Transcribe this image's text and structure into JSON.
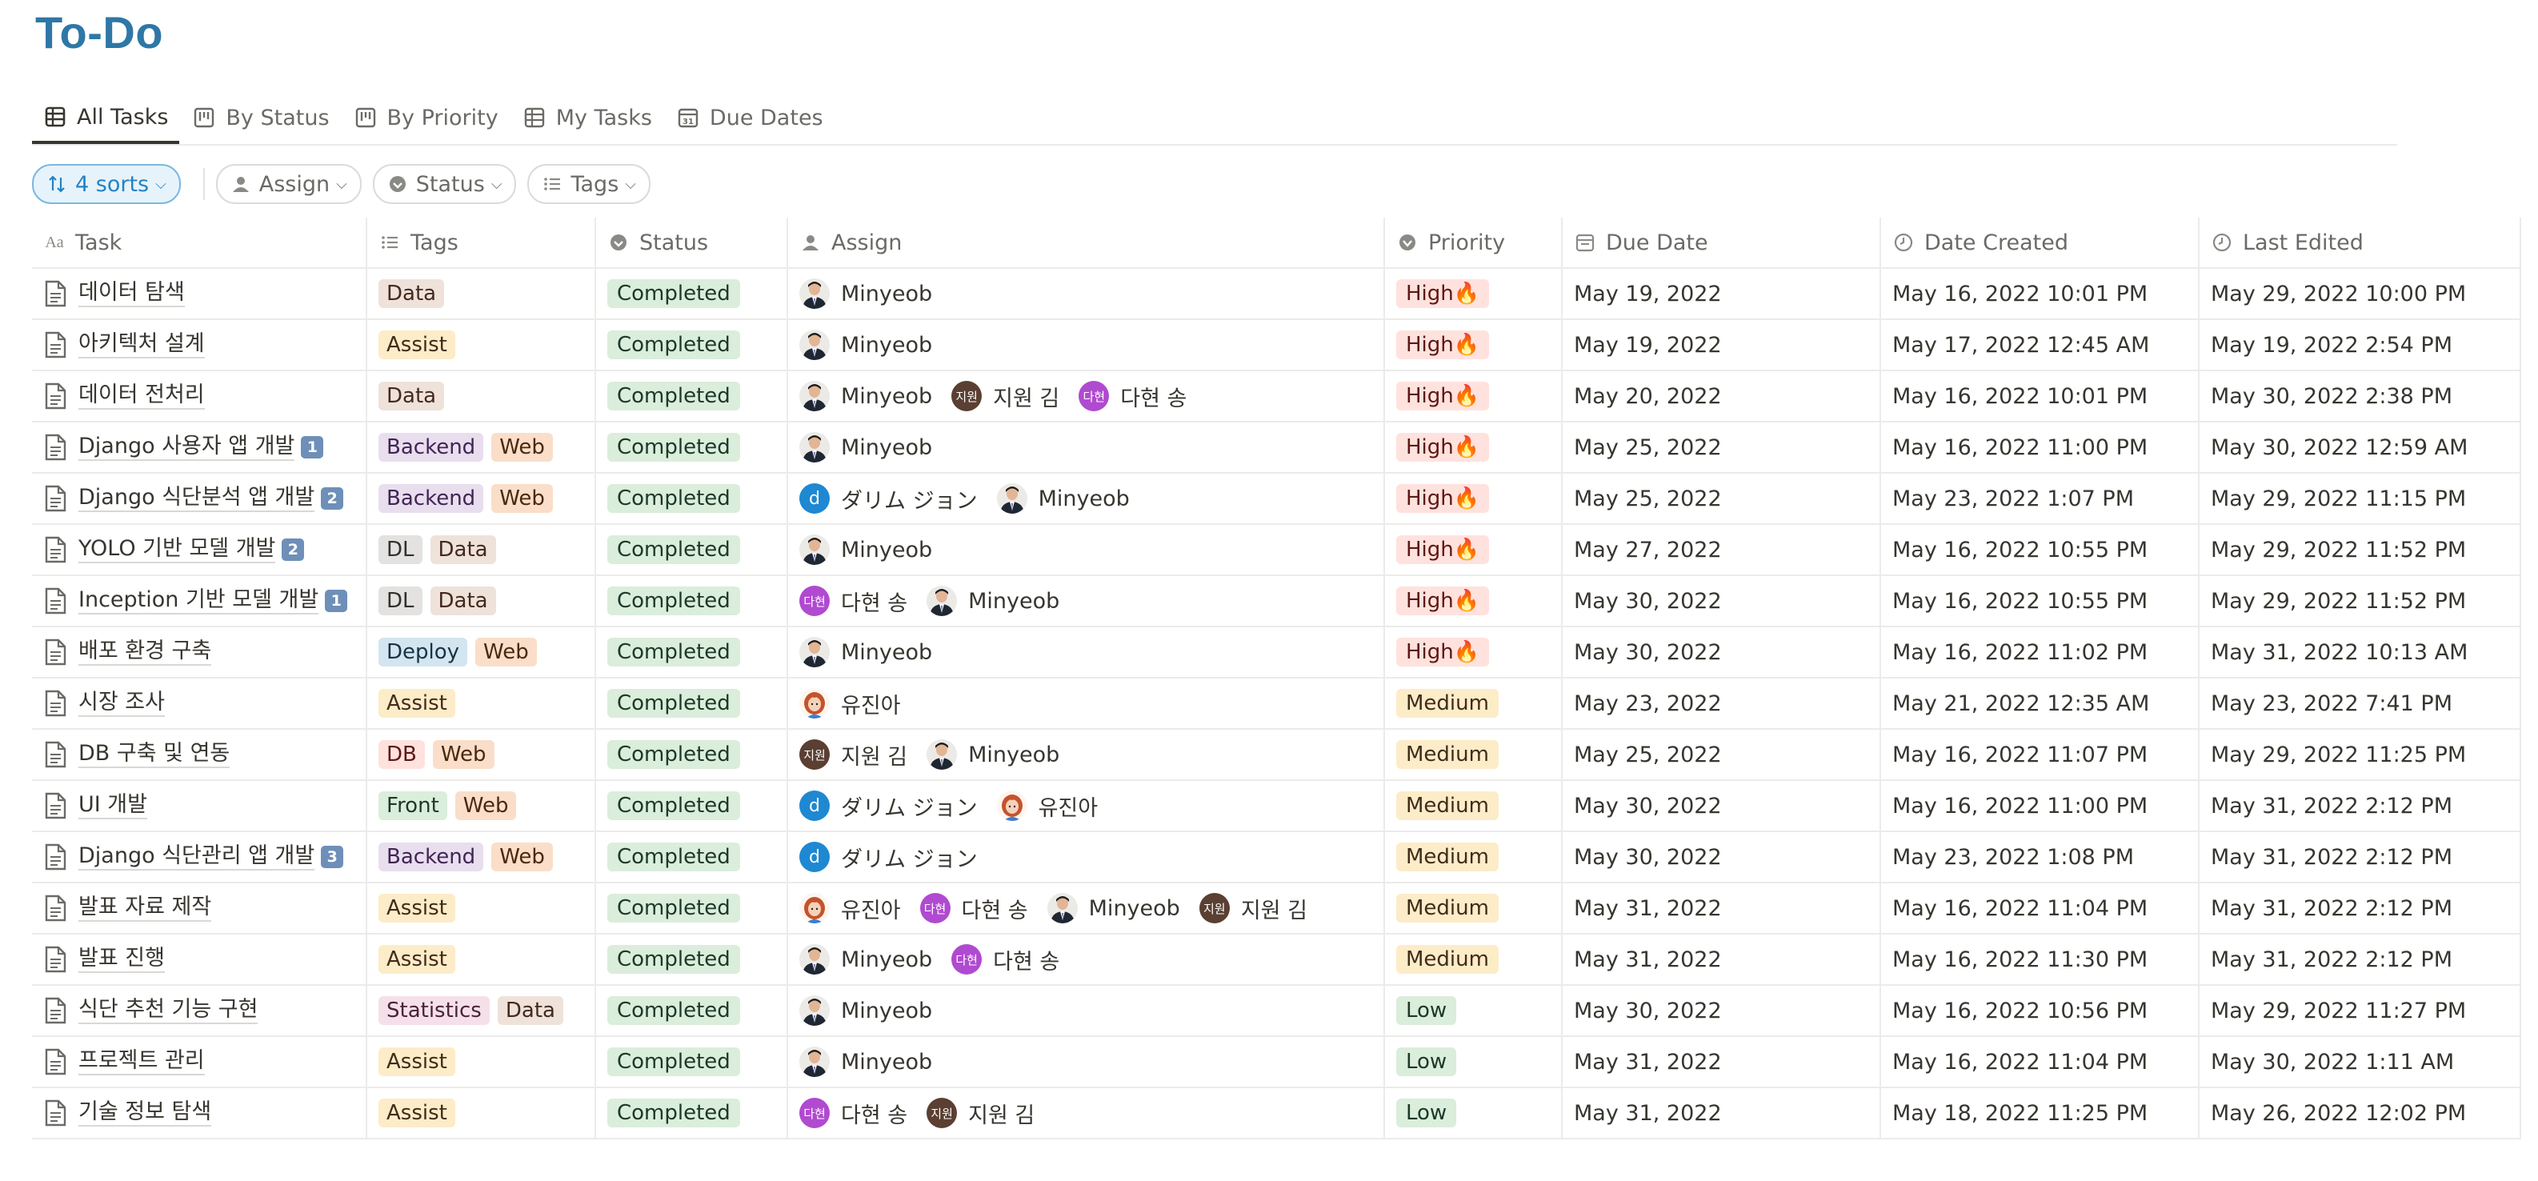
{
  "page": {
    "title": "To-Do"
  },
  "tabs": [
    {
      "label": "All Tasks",
      "icon": "table-icon",
      "active": true
    },
    {
      "label": "By Status",
      "icon": "board-icon",
      "active": false
    },
    {
      "label": "By Priority",
      "icon": "board-icon",
      "active": false
    },
    {
      "label": "My Tasks",
      "icon": "table-icon",
      "active": false
    },
    {
      "label": "Due Dates",
      "icon": "calendar-icon",
      "active": false
    }
  ],
  "filters": {
    "sort_label": "4 sorts",
    "assign_label": "Assign",
    "status_label": "Status",
    "tags_label": "Tags"
  },
  "columns": {
    "task": "Task",
    "tags": "Tags",
    "status": "Status",
    "assign": "Assign",
    "priority": "Priority",
    "due": "Due Date",
    "created": "Date Created",
    "edited": "Last Edited"
  },
  "rows": [
    {
      "task": "데이터 탐색",
      "num": "",
      "tags": [
        "Data"
      ],
      "status": "Completed",
      "assign": [
        "Minyeob"
      ],
      "priority": "High🔥",
      "due": "May 19, 2022",
      "created": "May 16, 2022 10:01 PM",
      "edited": "May 29, 2022 10:00 PM"
    },
    {
      "task": "아키텍처 설계",
      "num": "",
      "tags": [
        "Assist"
      ],
      "status": "Completed",
      "assign": [
        "Minyeob"
      ],
      "priority": "High🔥",
      "due": "May 19, 2022",
      "created": "May 17, 2022 12:45 AM",
      "edited": "May 19, 2022 2:54 PM"
    },
    {
      "task": "데이터 전처리",
      "num": "",
      "tags": [
        "Data"
      ],
      "status": "Completed",
      "assign": [
        "Minyeob",
        "지원 김",
        "다현 송"
      ],
      "priority": "High🔥",
      "due": "May 20, 2022",
      "created": "May 16, 2022 10:01 PM",
      "edited": "May 30, 2022 2:38 PM"
    },
    {
      "task": "Django 사용자 앱 개발",
      "num": "1",
      "tags": [
        "Backend",
        "Web"
      ],
      "status": "Completed",
      "assign": [
        "Minyeob"
      ],
      "priority": "High🔥",
      "due": "May 25, 2022",
      "created": "May 16, 2022 11:00 PM",
      "edited": "May 30, 2022 12:59 AM"
    },
    {
      "task": "Django 식단분석 앱 개발",
      "num": "2",
      "tags": [
        "Backend",
        "Web"
      ],
      "status": "Completed",
      "assign": [
        "ダリム ジョン",
        "Minyeob"
      ],
      "priority": "High🔥",
      "due": "May 25, 2022",
      "created": "May 23, 2022 1:07 PM",
      "edited": "May 29, 2022 11:15 PM"
    },
    {
      "task": "YOLO 기반 모델 개발",
      "num": "2",
      "tags": [
        "DL",
        "Data"
      ],
      "status": "Completed",
      "assign": [
        "Minyeob"
      ],
      "priority": "High🔥",
      "due": "May 27, 2022",
      "created": "May 16, 2022 10:55 PM",
      "edited": "May 29, 2022 11:52 PM"
    },
    {
      "task": "Inception 기반 모델 개발",
      "num": "1",
      "tags": [
        "DL",
        "Data"
      ],
      "status": "Completed",
      "assign": [
        "다현 송",
        "Minyeob"
      ],
      "priority": "High🔥",
      "due": "May 30, 2022",
      "created": "May 16, 2022 10:55 PM",
      "edited": "May 29, 2022 11:52 PM"
    },
    {
      "task": "배포 환경 구축",
      "num": "",
      "tags": [
        "Deploy",
        "Web"
      ],
      "status": "Completed",
      "assign": [
        "Minyeob"
      ],
      "priority": "High🔥",
      "due": "May 30, 2022",
      "created": "May 16, 2022 11:02 PM",
      "edited": "May 31, 2022 10:13 AM"
    },
    {
      "task": "시장 조사",
      "num": "",
      "tags": [
        "Assist"
      ],
      "status": "Completed",
      "assign": [
        "유진아"
      ],
      "priority": "Medium",
      "due": "May 23, 2022",
      "created": "May 21, 2022 12:35 AM",
      "edited": "May 23, 2022 7:41 PM"
    },
    {
      "task": "DB 구축 및 연동",
      "num": "",
      "tags": [
        "DB",
        "Web"
      ],
      "status": "Completed",
      "assign": [
        "지원 김",
        "Minyeob"
      ],
      "priority": "Medium",
      "due": "May 25, 2022",
      "created": "May 16, 2022 11:07 PM",
      "edited": "May 29, 2022 11:25 PM"
    },
    {
      "task": "UI 개발",
      "num": "",
      "tags": [
        "Front",
        "Web"
      ],
      "status": "Completed",
      "assign": [
        "ダリム ジョン",
        "유진아"
      ],
      "priority": "Medium",
      "due": "May 30, 2022",
      "created": "May 16, 2022 11:00 PM",
      "edited": "May 31, 2022 2:12 PM"
    },
    {
      "task": "Django 식단관리 앱 개발",
      "num": "3",
      "tags": [
        "Backend",
        "Web"
      ],
      "status": "Completed",
      "assign": [
        "ダリム ジョン"
      ],
      "priority": "Medium",
      "due": "May 30, 2022",
      "created": "May 23, 2022 1:08 PM",
      "edited": "May 31, 2022 2:12 PM"
    },
    {
      "task": "발표 자료 제작",
      "num": "",
      "tags": [
        "Assist"
      ],
      "status": "Completed",
      "assign": [
        "유진아",
        "다현 송",
        "Minyeob",
        "지원 김"
      ],
      "priority": "Medium",
      "due": "May 31, 2022",
      "created": "May 16, 2022 11:04 PM",
      "edited": "May 31, 2022 2:12 PM"
    },
    {
      "task": "발표 진행",
      "num": "",
      "tags": [
        "Assist"
      ],
      "status": "Completed",
      "assign": [
        "Minyeob",
        "다현 송"
      ],
      "priority": "Medium",
      "due": "May 31, 2022",
      "created": "May 16, 2022 11:30 PM",
      "edited": "May 31, 2022 2:12 PM"
    },
    {
      "task": "식단 추천 기능 구현",
      "num": "",
      "tags": [
        "Statistics",
        "Data"
      ],
      "status": "Completed",
      "assign": [
        "Minyeob"
      ],
      "priority": "Low",
      "due": "May 30, 2022",
      "created": "May 16, 2022 10:56 PM",
      "edited": "May 29, 2022 11:27 PM"
    },
    {
      "task": "프로젝트 관리",
      "num": "",
      "tags": [
        "Assist"
      ],
      "status": "Completed",
      "assign": [
        "Minyeob"
      ],
      "priority": "Low",
      "due": "May 31, 2022",
      "created": "May 16, 2022 11:04 PM",
      "edited": "May 30, 2022 1:11 AM"
    },
    {
      "task": "기술 정보 탐색",
      "num": "",
      "tags": [
        "Assist"
      ],
      "status": "Completed",
      "assign": [
        "다현 송",
        "지원 김"
      ],
      "priority": "Low",
      "due": "May 31, 2022",
      "created": "May 18, 2022 11:25 PM",
      "edited": "May 26, 2022 12:02 PM"
    }
  ],
  "avatars": {
    "다현 송": "다현",
    "지원 김": "지원",
    "ダリム ジョン": "d"
  }
}
